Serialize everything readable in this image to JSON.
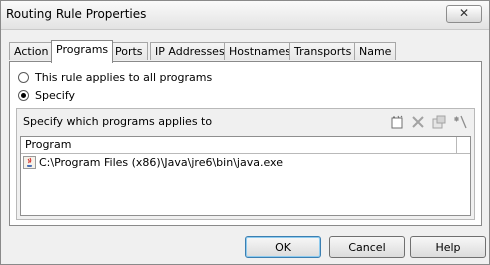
{
  "window": {
    "title": "Routing Rule Properties",
    "close_glyph": "✕"
  },
  "tabs": [
    {
      "label": "Action"
    },
    {
      "label": "Programs",
      "selected": true
    },
    {
      "label": "Ports"
    },
    {
      "label": "IP Addresses"
    },
    {
      "label": "Hostnames"
    },
    {
      "label": "Transports"
    },
    {
      "label": "Name"
    }
  ],
  "programs": {
    "options": [
      {
        "label": "This rule applies to all programs",
        "selected": false
      },
      {
        "label": "Specify",
        "selected": true
      }
    ],
    "group_caption": "Specify which programs applies to",
    "toolbar": [
      {
        "icon": "new-item-icon",
        "enabled": true
      },
      {
        "icon": "delete-icon",
        "enabled": false
      },
      {
        "icon": "properties-icon",
        "enabled": false
      },
      {
        "icon": "wildcard-icon",
        "enabled": true
      }
    ],
    "list": {
      "column_header": "Program",
      "items": [
        {
          "icon": "java-icon",
          "path": "C:\\Program Files (x86)\\Java\\jre6\\bin\\java.exe"
        }
      ]
    }
  },
  "buttons": {
    "ok": "OK",
    "cancel": "Cancel",
    "help": "Help"
  }
}
